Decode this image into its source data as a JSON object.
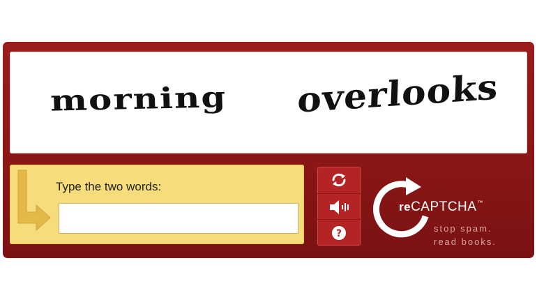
{
  "captcha": {
    "word_1": "morning",
    "word_2": "overlooks"
  },
  "answer": {
    "prompt": "Type the two words:",
    "value": "",
    "placeholder": ""
  },
  "controls": {
    "refresh_icon": "refresh-icon",
    "audio_icon": "speaker-icon",
    "help_icon": "help-icon"
  },
  "branding": {
    "logo_prefix": "re",
    "logo_name": "CAPTCHA",
    "trademark": "™",
    "tagline_1": "stop spam.",
    "tagline_2": "read books."
  },
  "colors": {
    "frame": "#8b1616",
    "answer_panel": "#f6dc7b",
    "control_button": "#b42424",
    "tagline": "#d9a6a6"
  }
}
